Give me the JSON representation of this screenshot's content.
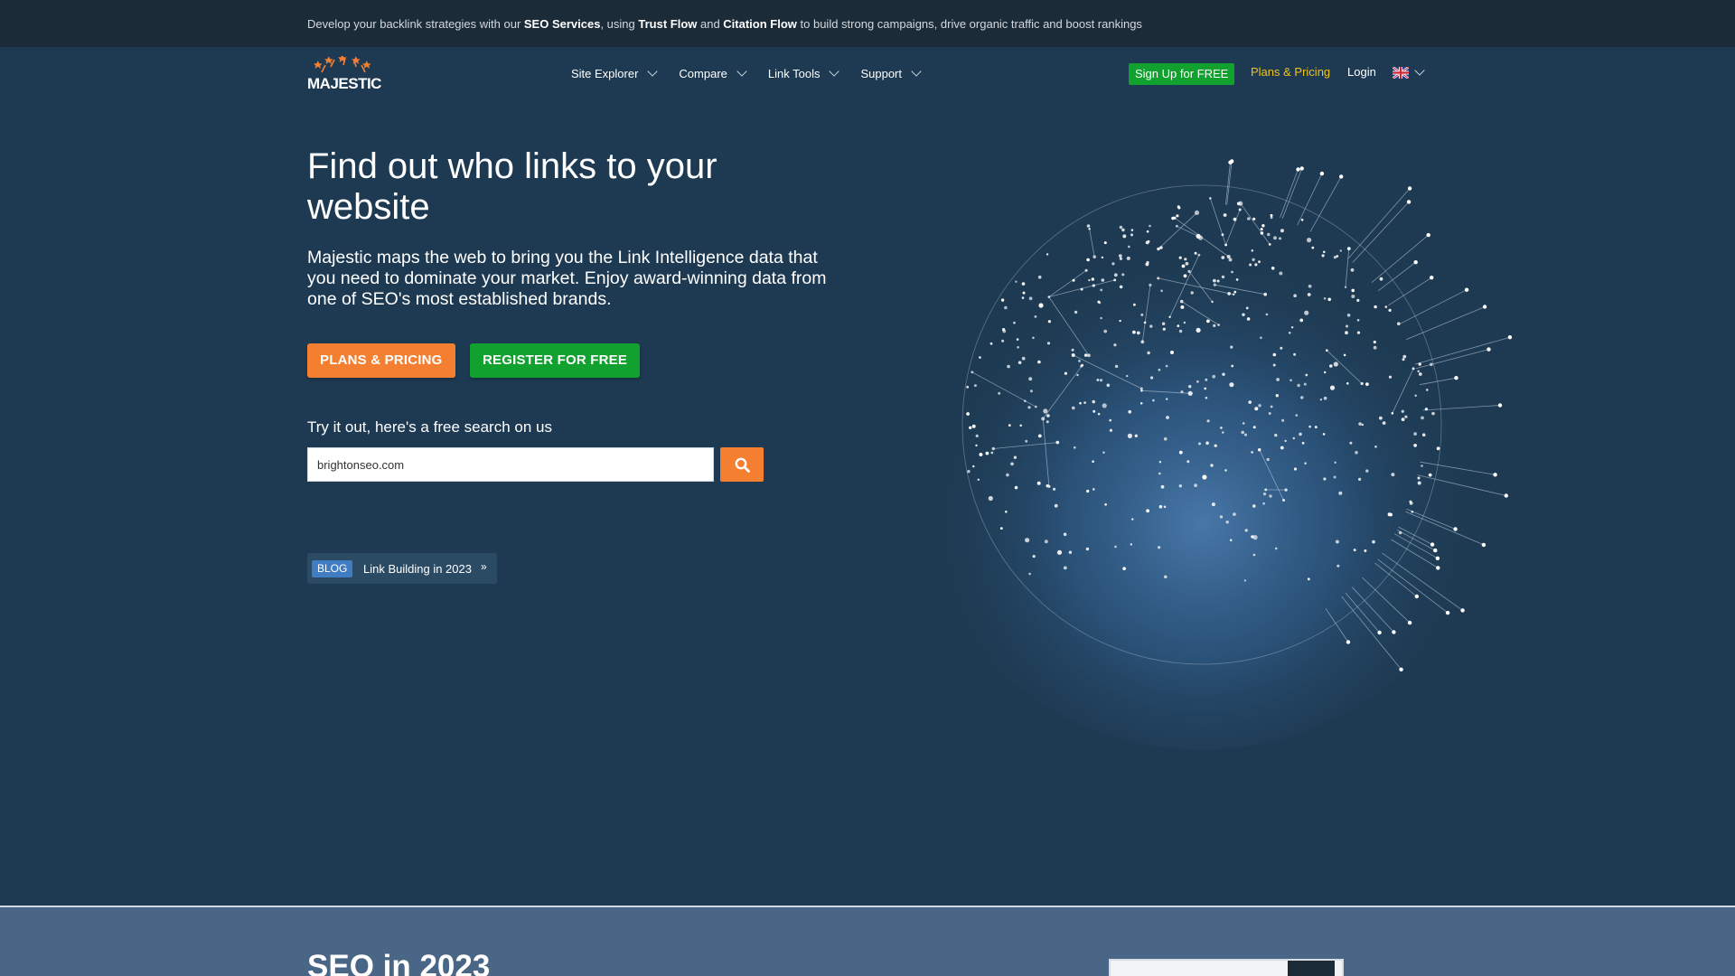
{
  "topbar": {
    "text_1": "Develop your backlink strategies with our ",
    "seo_services": "SEO Services",
    "text_2": ", using ",
    "trust_flow": "Trust Flow",
    "text_3": " and ",
    "citation_flow": "Citation Flow",
    "text_4": " to build strong campaigns, drive organic traffic and boost rankings"
  },
  "nav": {
    "logo_text": "MAJESTIC",
    "items": [
      {
        "label": "Site Explorer"
      },
      {
        "label": "Compare"
      },
      {
        "label": "Link Tools"
      },
      {
        "label": "Support"
      }
    ],
    "signup_label": "Sign Up for FREE",
    "plans_label": "Plans & Pricing",
    "login_label": "Login",
    "language_icon": "uk-flag-icon"
  },
  "hero": {
    "title": "Find out who links to your website",
    "subtitle": "Majestic maps the web to bring you the Link Intelligence data that you need to dominate your market. Enjoy award-winning data from one of SEO's most established brands.",
    "plans_button": "PLANS & PRICING",
    "register_button": "REGISTER FOR FREE",
    "try_label": "Try it out, here's a free search on us",
    "search_value": "brightonseo.com",
    "search_icon": "search-icon"
  },
  "blog": {
    "badge": "BLOG",
    "text": "Link Building in 2023",
    "arrow": "»"
  },
  "section2": {
    "title": "SEO in 2023"
  },
  "colors": {
    "background": "#1e3a52",
    "topbar": "#1b2b38",
    "orange": "#f57f30",
    "green": "#10a12e",
    "gold_link": "#f0c21c",
    "blog_badge": "#3f7cc1"
  }
}
